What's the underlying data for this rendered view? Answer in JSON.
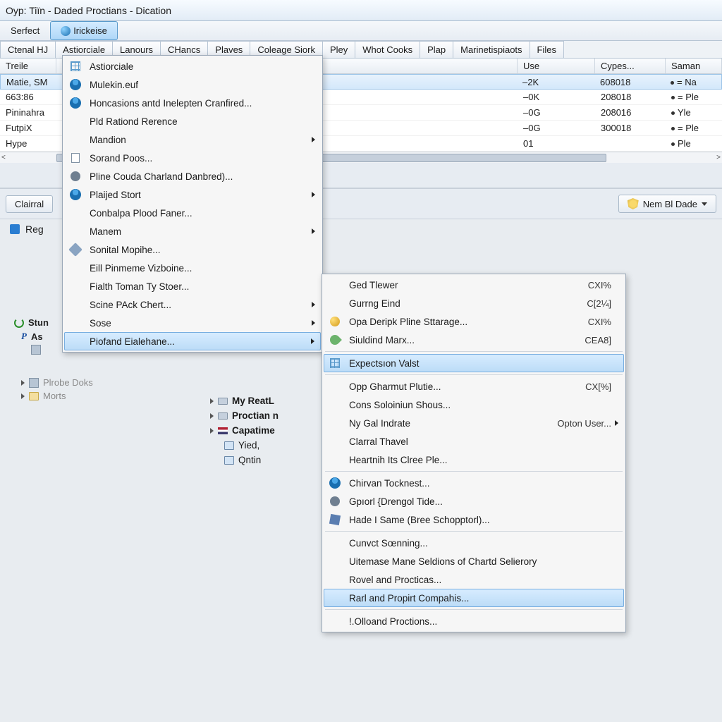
{
  "window": {
    "title": "Oyp: Tiïn - Daded Proctians - Dication"
  },
  "menubar": {
    "items": [
      {
        "label": "Serfect"
      },
      {
        "label": "Irickeise",
        "active": true
      }
    ]
  },
  "tabs": [
    "Ctenal HJ",
    "Astiorciale",
    "Lanours",
    "CHancs",
    "Plaves",
    "Coleage Siork",
    "Pley",
    "Whot Cooks",
    "Plap",
    "Marinetispiaots",
    "Files"
  ],
  "grid": {
    "headers": {
      "a": "Treile",
      "use": "Use",
      "cyp": "Cypes...",
      "sam": "Saman"
    },
    "rows": [
      {
        "a": "Matie, SM",
        "use": "–2K",
        "cyp": "608018",
        "sam": "= Na",
        "selected": true
      },
      {
        "a": "663:86",
        "use": "–0K",
        "cyp": "208018",
        "sam": "= Ple"
      },
      {
        "a": "Pininahra",
        "use": "–0G",
        "cyp": "208016",
        "sam": "Yle"
      },
      {
        "a": "FutpiX",
        "use": "–0G",
        "cyp": "300018",
        "sam": "= Ple"
      },
      {
        "a": "Hype",
        "use": "01",
        "cyp": "",
        "sam": "Ple"
      }
    ]
  },
  "midbar": {
    "left_button": "Clairral",
    "panel_label": "Reg",
    "right_button": "Nem Bl Dade"
  },
  "left_tree": {
    "title": "Stun",
    "items": [
      {
        "label": "As",
        "icon": "p"
      },
      {
        "label": "Plrobe Doks",
        "icon": "sq",
        "faded": true
      },
      {
        "label": "Morts",
        "icon": "folder",
        "faded": true
      }
    ]
  },
  "mid_tree": [
    {
      "label": "My ReatL",
      "icon": "drive"
    },
    {
      "label": "Proctian n",
      "icon": "drive2"
    },
    {
      "label": "Capatime",
      "icon": "flag"
    },
    {
      "label": "Yied,",
      "icon": "monitor",
      "leaf": true
    },
    {
      "label": "Qntin",
      "icon": "monitor",
      "leaf": true
    }
  ],
  "menu1": [
    {
      "label": "Astiorciale",
      "icon": "grid"
    },
    {
      "label": "Mulekin.euf",
      "icon": "person"
    },
    {
      "label": "Honcasions antd Inelepten Cranfired...",
      "icon": "person"
    },
    {
      "label": "Pld Rationd Rerence"
    },
    {
      "label": "Mandion",
      "submenu": true
    },
    {
      "label": "Sorand Poos...",
      "icon": "file"
    },
    {
      "label": "Pline Couda Charland Danbred)...",
      "icon": "gear"
    },
    {
      "label": "Plaijed Stort",
      "icon": "person",
      "submenu": true
    },
    {
      "label": "Conbalpa Plood Faner..."
    },
    {
      "label": "Manem",
      "submenu": true
    },
    {
      "label": "Sonital Mopihe...",
      "icon": "wrench"
    },
    {
      "label": "Eill Pinmeme Vizboine..."
    },
    {
      "label": "Fialth Toman Ty Stoer..."
    },
    {
      "label": "Scine PAck Chert...",
      "submenu": true
    },
    {
      "label": "Sose",
      "submenu": true
    },
    {
      "label": "Piofand Eialehane...",
      "submenu": true,
      "hover": true
    }
  ],
  "menu2": [
    {
      "label": "Ged Tlewer",
      "shortcut": "CXI%"
    },
    {
      "label": "Gurrng Eind",
      "shortcut": "C[2¼]"
    },
    {
      "label": "Opa Deripk Pline Sttarage...",
      "icon": "ball",
      "shortcut": "CXI%"
    },
    {
      "label": "Siuldind Marx...",
      "icon": "leaf",
      "shortcut": "CEA8]"
    },
    {
      "sep": true
    },
    {
      "label": "Expectsıon Valst",
      "icon": "grid",
      "hover": true
    },
    {
      "sep": true
    },
    {
      "label": "Opp Gharmut Plutie...",
      "shortcut": "CX[%]"
    },
    {
      "label": "Cons Soloiniun Shous..."
    },
    {
      "label": "Ny Gal Indrate",
      "shortcut": "Opton User...",
      "submenu": true
    },
    {
      "label": "Clarral Thavel"
    },
    {
      "label": "Heartnih Its Clree Ple..."
    },
    {
      "sep": true
    },
    {
      "label": "Chirvan Tocknest...",
      "icon": "person"
    },
    {
      "label": "Gpıorl {Drengol Tide...",
      "icon": "gear"
    },
    {
      "label": "Hade I Same (Bree Schopptorl)...",
      "icon": "cube"
    },
    {
      "sep": true
    },
    {
      "label": "Cunvct Sœnning..."
    },
    {
      "label": "Uitemase Mane Seldions of Chartd Selierory"
    },
    {
      "label": "Rovel and Procticas..."
    },
    {
      "label": "Rarl and Propirt Compahis...",
      "hover": true
    },
    {
      "sep": true
    },
    {
      "label": "!.Olloand Proctions..."
    }
  ]
}
